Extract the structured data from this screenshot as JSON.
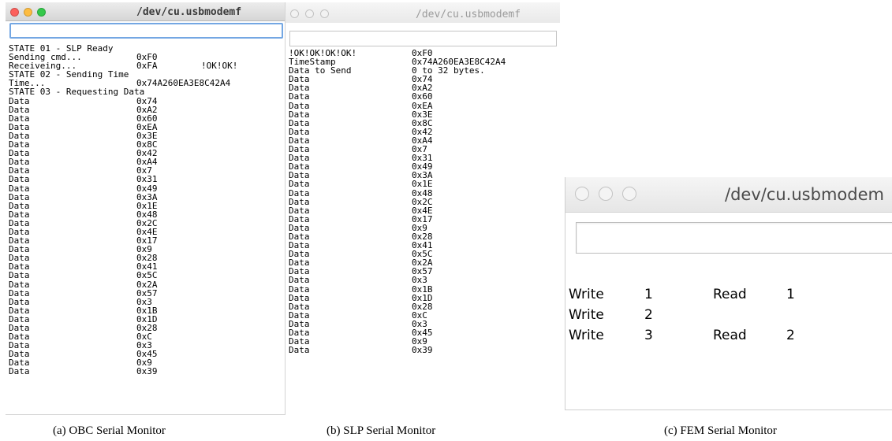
{
  "windows": [
    {
      "id": "winA",
      "title": "/dev/cu.usbmodemf",
      "lights": [
        "#fc605c",
        "#fdbc40",
        "#34c84a"
      ],
      "lights_active": true,
      "col2": 166,
      "col3": 248,
      "rows": [
        [
          "STATE 01 - SLP Ready"
        ],
        [
          "Sending cmd...",
          "0xF0"
        ],
        [
          "Receiveing...",
          "0xFA",
          "!OK!OK!"
        ],
        [
          "STATE 02 - Sending Time"
        ],
        [
          "Time...",
          "0x74A260EA3E8C42A4"
        ],
        [
          "STATE 03 - Requesting Data"
        ],
        [
          "Data",
          "0x74"
        ],
        [
          "Data",
          "0xA2"
        ],
        [
          "Data",
          "0x60"
        ],
        [
          "Data",
          "0xEA"
        ],
        [
          "Data",
          "0x3E"
        ],
        [
          "Data",
          "0x8C"
        ],
        [
          "Data",
          "0x42"
        ],
        [
          "Data",
          "0xA4"
        ],
        [
          "Data",
          "0x7"
        ],
        [
          "Data",
          "0x31"
        ],
        [
          "Data",
          "0x49"
        ],
        [
          "Data",
          "0x3A"
        ],
        [
          "Data",
          "0x1E"
        ],
        [
          "Data",
          "0x48"
        ],
        [
          "Data",
          "0x2C"
        ],
        [
          "Data",
          "0x4E"
        ],
        [
          "Data",
          "0x17"
        ],
        [
          "Data",
          "0x9"
        ],
        [
          "Data",
          "0x28"
        ],
        [
          "Data",
          "0x41"
        ],
        [
          "Data",
          "0x5C"
        ],
        [
          "Data",
          "0x2A"
        ],
        [
          "Data",
          "0x57"
        ],
        [
          "Data",
          "0x3"
        ],
        [
          "Data",
          "0x1B"
        ],
        [
          "Data",
          "0x1D"
        ],
        [
          "Data",
          "0x28"
        ],
        [
          "Data",
          "0xC"
        ],
        [
          "Data",
          "0x3"
        ],
        [
          "Data",
          "0x45"
        ],
        [
          "Data",
          "0x9"
        ],
        [
          "Data",
          "0x39"
        ]
      ]
    },
    {
      "id": "winB",
      "title": "/dev/cu.usbmodemf",
      "lights": [
        "#f2f2f2",
        "#f2f2f2",
        "#f2f2f2"
      ],
      "lights_active": false,
      "col2": 160,
      "rows": [
        [
          "!OK!OK!OK!OK!",
          "0xF0"
        ],
        [
          "TimeStamp",
          "0x74A260EA3E8C42A4"
        ],
        [
          "Data to Send",
          "0 to 32 bytes."
        ],
        [
          "Data",
          "0x74"
        ],
        [
          "Data",
          "0xA2"
        ],
        [
          "Data",
          "0x60"
        ],
        [
          "Data",
          "0xEA"
        ],
        [
          "Data",
          "0x3E"
        ],
        [
          "Data",
          "0x8C"
        ],
        [
          "Data",
          "0x42"
        ],
        [
          "Data",
          "0xA4"
        ],
        [
          "Data",
          "0x7"
        ],
        [
          "Data",
          "0x31"
        ],
        [
          "Data",
          "0x49"
        ],
        [
          "Data",
          "0x3A"
        ],
        [
          "Data",
          "0x1E"
        ],
        [
          "Data",
          "0x48"
        ],
        [
          "Data",
          "0x2C"
        ],
        [
          "Data",
          "0x4E"
        ],
        [
          "Data",
          "0x17"
        ],
        [
          "Data",
          "0x9"
        ],
        [
          "Data",
          "0x28"
        ],
        [
          "Data",
          "0x41"
        ],
        [
          "Data",
          "0x5C"
        ],
        [
          "Data",
          "0x2A"
        ],
        [
          "Data",
          "0x57"
        ],
        [
          "Data",
          "0x3"
        ],
        [
          "Data",
          "0x1B"
        ],
        [
          "Data",
          "0x1D"
        ],
        [
          "Data",
          "0x28"
        ],
        [
          "Data",
          "0xC"
        ],
        [
          "Data",
          "0x3"
        ],
        [
          "Data",
          "0x45"
        ],
        [
          "Data",
          "0x9"
        ],
        [
          "Data",
          "0x39"
        ]
      ]
    },
    {
      "id": "winC",
      "title": "/dev/cu.usbmodem",
      "lights": [
        "#f4f4f4",
        "#f4f4f4",
        "#f4f4f4"
      ],
      "lights_active": false,
      "rows": [
        [
          "Write",
          "1",
          "Read",
          "1"
        ],
        [
          "Write",
          "2"
        ],
        [
          "Write",
          "3",
          "Read",
          "2"
        ]
      ]
    }
  ],
  "captions": [
    "(a) OBC Serial Monitor",
    "(b) SLP Serial Monitor",
    "(c) FEM Serial Monitor"
  ]
}
